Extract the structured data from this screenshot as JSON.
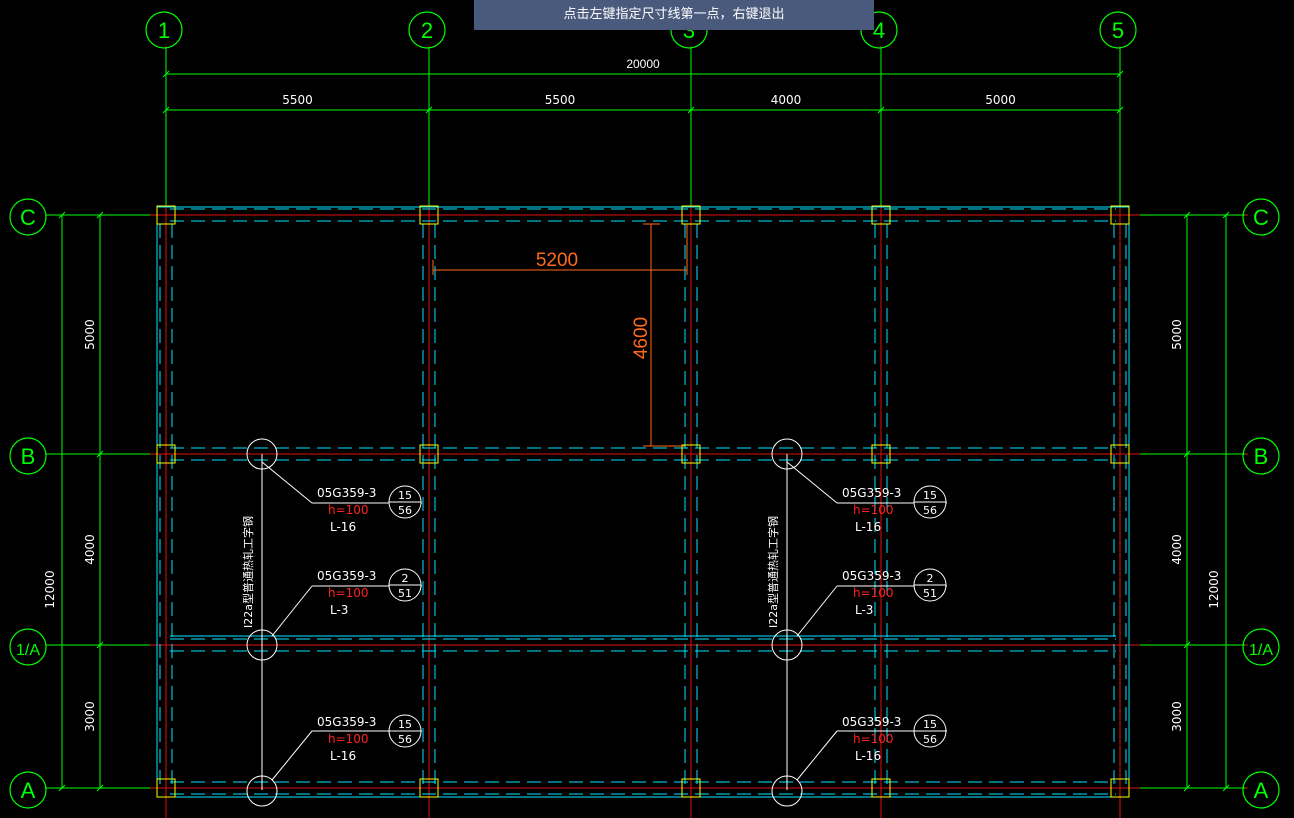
{
  "prompt_text": "点击左键指定尺寸线第一点，右键退出",
  "axes_vertical": [
    "1",
    "2",
    "3",
    "4",
    "5"
  ],
  "axes_horizontal": [
    "C",
    "B",
    "1/A",
    "A"
  ],
  "dims_top": {
    "overall": "20000",
    "spans": [
      "5500",
      "5500",
      "4000",
      "5000"
    ]
  },
  "dims_side": {
    "overall": "12000",
    "spans": [
      "5000",
      "4000",
      "3000"
    ]
  },
  "measured": {
    "horizontal": "5200",
    "vertical": "4600"
  },
  "rebar_note": "I22a型普通热轧工字钢",
  "tags": [
    {
      "code": "05G359-3",
      "h": "h=100",
      "label": "L-16",
      "num_top": "15",
      "num_bottom": "56"
    },
    {
      "code": "05G359-3",
      "h": "h=100",
      "label": "L-3",
      "num_top": "2",
      "num_bottom": "51"
    },
    {
      "code": "05G359-3",
      "h": "h=100",
      "label": "L-16",
      "num_top": "15",
      "num_bottom": "56"
    }
  ],
  "colors": {
    "axis": "#e01010",
    "dim": "#00ff00",
    "beam": "#00e5ff",
    "column": "#ffff00",
    "measure": "#ff6a1a",
    "text": "#ffffff",
    "h_text": "#ff2020",
    "bubble": "#00ff00"
  }
}
